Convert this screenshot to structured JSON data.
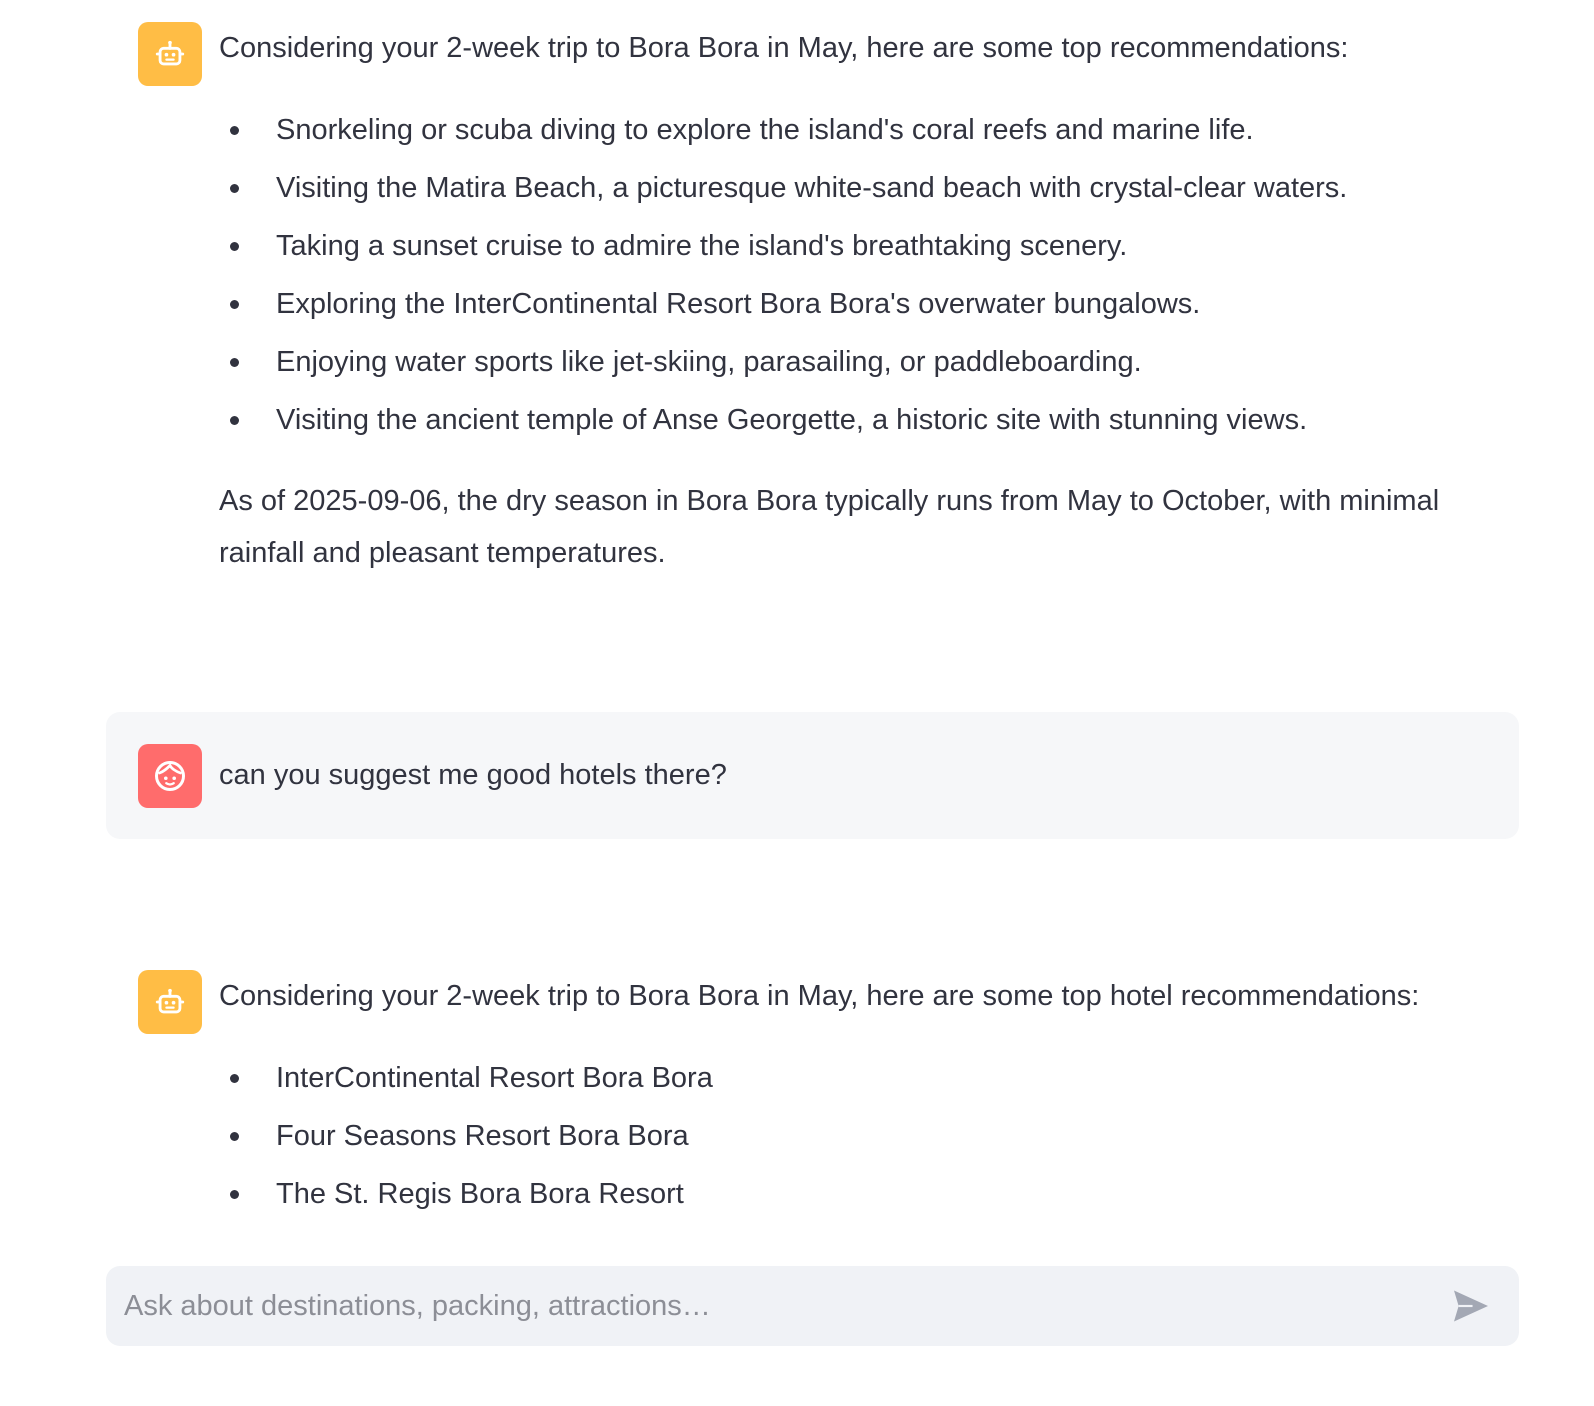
{
  "colors": {
    "bot_avatar": "#ffbd45",
    "user_avatar": "#ff6c6c",
    "user_bubble": "#f6f7f9",
    "input_bg": "#f0f2f6",
    "text": "#31333f",
    "placeholder": "#8c8e96"
  },
  "messages": [
    {
      "role": "assistant",
      "avatar_icon": "robot-icon",
      "intro": "Considering your 2-week trip to Bora Bora in May, here are some top recommendations:",
      "bullets": [
        "Snorkeling or scuba diving to explore the island's coral reefs and marine life.",
        "Visiting the Matira Beach, a picturesque white-sand beach with crystal-clear waters.",
        "Taking a sunset cruise to admire the island's breathtaking scenery.",
        "Exploring the InterContinental Resort Bora Bora's overwater bungalows.",
        "Enjoying water sports like jet-skiing, parasailing, or paddleboarding.",
        "Visiting the ancient temple of Anse Georgette, a historic site with stunning views."
      ],
      "paragraph": "As of 2025-09-06, the dry season in Bora Bora typically runs from May to October, with minimal rainfall and pleasant temperatures."
    },
    {
      "role": "user",
      "avatar_icon": "face-icon",
      "text": "can you suggest me good hotels there?"
    },
    {
      "role": "assistant",
      "avatar_icon": "robot-icon",
      "intro": "Considering your 2-week trip to Bora Bora in May, here are some top hotel recommendations:",
      "bullets": [
        "InterContinental Resort Bora Bora",
        "Four Seasons Resort Bora Bora",
        "The St. Regis Bora Bora Resort"
      ]
    }
  ],
  "chat_input": {
    "placeholder": "Ask about destinations, packing, attractions…",
    "value": "",
    "send_icon": "send-icon"
  }
}
